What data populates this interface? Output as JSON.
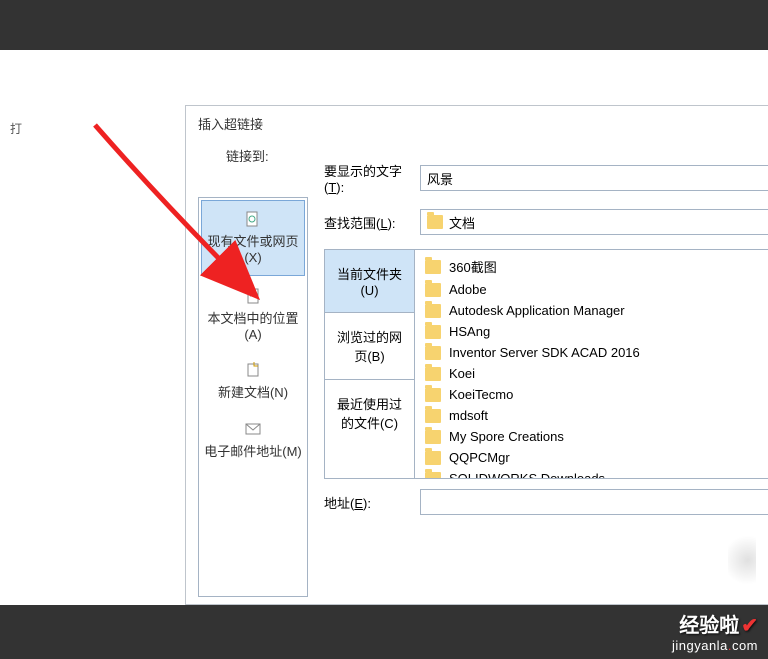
{
  "outer": {
    "left_hint": "打"
  },
  "dialog": {
    "title": "插入超链接",
    "link_to_label": "链接到:",
    "display_text_label": "要显示的文字(",
    "display_text_key": "T",
    "display_text_value": "风景",
    "lookup_label": "查找范围(",
    "lookup_key": "L",
    "lookup_value": "文档",
    "address_label": "地址(",
    "address_key": "E",
    "address_value": ""
  },
  "linkto": [
    {
      "label": "现有文件或网页(",
      "key": "X",
      "selected": true
    },
    {
      "label": "本文档中的位置(",
      "key": "A",
      "selected": false
    },
    {
      "label": "新建文档(",
      "key": "N",
      "selected": false
    },
    {
      "label": "电子邮件地址(",
      "key": "M",
      "selected": false
    }
  ],
  "browse_tabs": [
    {
      "label": "当前文件夹(",
      "key": "U",
      "selected": true
    },
    {
      "label": "浏览过的网页(",
      "key": "B",
      "selected": false
    },
    {
      "label": "最近使用过的文件(",
      "key": "C",
      "selected": false
    }
  ],
  "files": [
    "360截图",
    "Adobe",
    "Autodesk Application Manager",
    "HSAng",
    "Inventor Server SDK ACAD 2016",
    "Koei",
    "KoeiTecmo",
    "mdsoft",
    "My Spore Creations",
    "QQPCMgr",
    "SOLIDWORKS Downloads"
  ],
  "watermark": {
    "brand": "经验啦",
    "url_pre": "jingyanla",
    "url_dot": ".",
    "url_suf": "com"
  }
}
